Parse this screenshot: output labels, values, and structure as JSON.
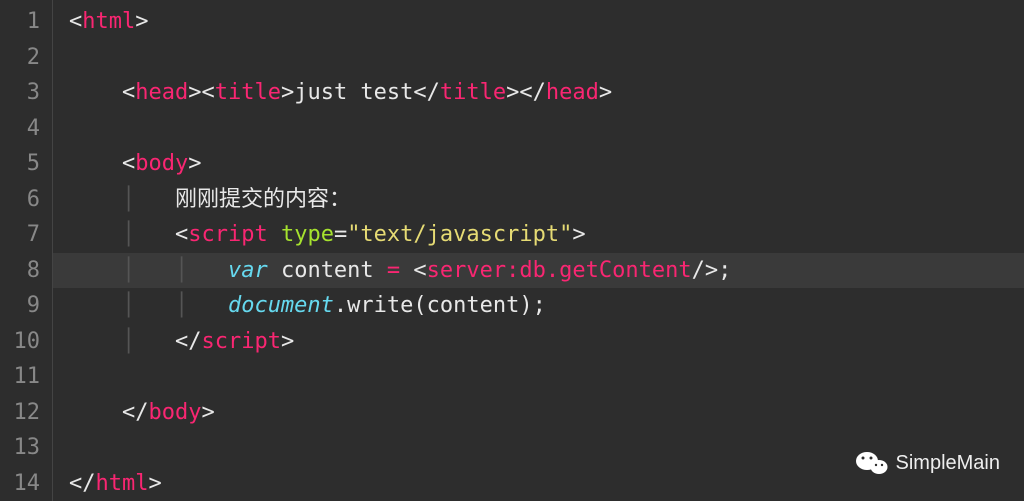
{
  "gutter": {
    "lines": [
      "1",
      "2",
      "3",
      "4",
      "5",
      "6",
      "7",
      "8",
      "9",
      "10",
      "11",
      "12",
      "13",
      "14"
    ]
  },
  "code": {
    "l1": {
      "open": "<",
      "tag": "html",
      "close": ">"
    },
    "l3": {
      "headOpen": {
        "lt": "<",
        "name": "head",
        "gt": ">"
      },
      "titleOpen": {
        "lt": "<",
        "name": "title",
        "gt": ">"
      },
      "titleText": "just test",
      "titleClose": {
        "lt": "</",
        "name": "title",
        "gt": ">"
      },
      "headClose": {
        "lt": "</",
        "name": "head",
        "gt": ">"
      }
    },
    "l5": {
      "lt": "<",
      "name": "body",
      "gt": ">"
    },
    "l6": {
      "text": "刚刚提交的内容："
    },
    "l7": {
      "lt": "<",
      "name": "script",
      "sp": " ",
      "attr": "type",
      "eq": "=",
      "val": "\"text/javascript\"",
      "gt": ">"
    },
    "l8": {
      "kw": "var",
      "sp1": " ",
      "var": "content",
      "sp2": " ",
      "eq": "=",
      "sp3": " ",
      "lt": "<",
      "srv": "server:db.getContent",
      "slash": "/",
      "gt": ">",
      "semi": ";"
    },
    "l9": {
      "obj": "document",
      "dot": ".",
      "fn": "write",
      "lp": "(",
      "arg": "content",
      "rp": ")",
      "semi": ";"
    },
    "l10": {
      "lt": "</",
      "name": "script",
      "gt": ">"
    },
    "l12": {
      "lt": "</",
      "name": "body",
      "gt": ">"
    },
    "l14": {
      "lt": "</",
      "name": "html",
      "gt": ">"
    }
  },
  "watermark": {
    "label": "SimpleMain"
  }
}
